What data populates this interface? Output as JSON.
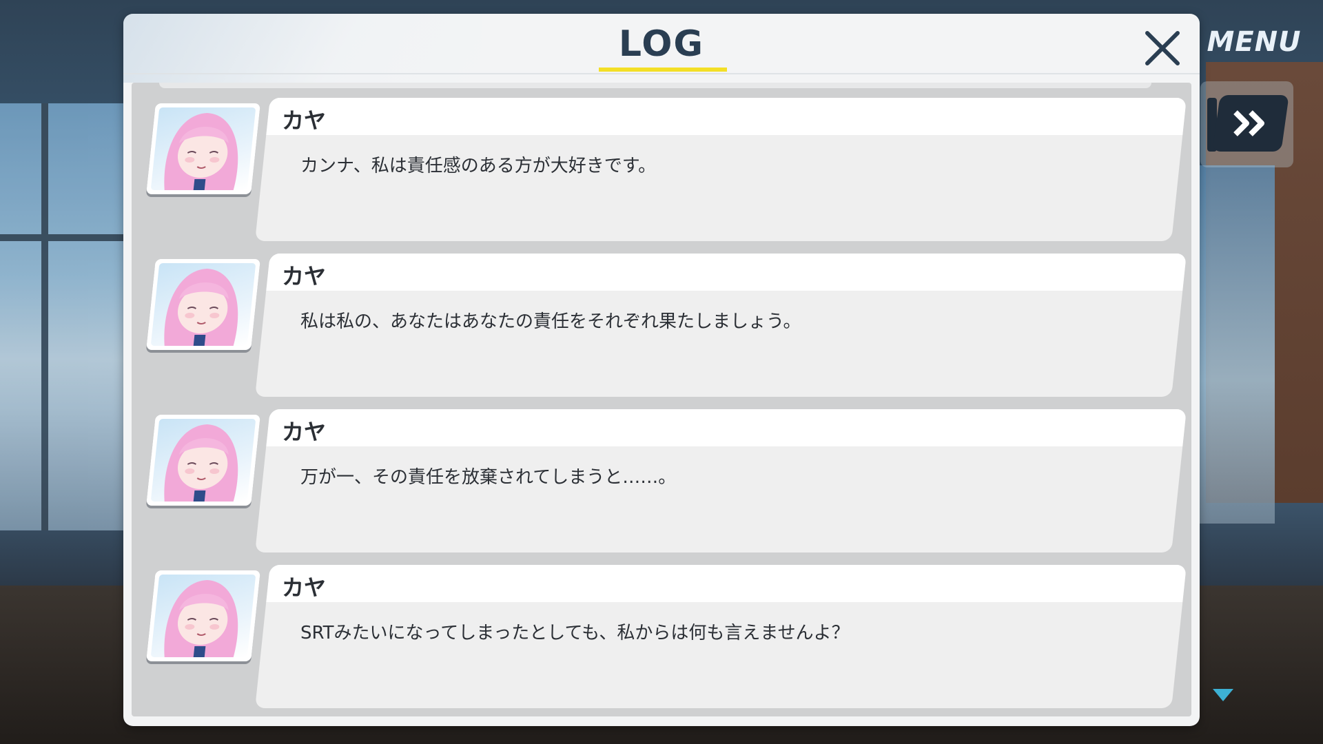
{
  "hud": {
    "menu_label": "MENU",
    "skip_icon": "double-chevron-right-icon",
    "scroll_icon": "triangle-down-icon",
    "accent_color": "#f3df26"
  },
  "log": {
    "title": "LOG",
    "close_icon": "close-x-icon",
    "entries": [
      {
        "speaker": "カヤ",
        "text": "カンナ、私は責任感のある方が大好きです。"
      },
      {
        "speaker": "カヤ",
        "text": "私は私の、あなたはあなたの責任をそれぞれ果たしましょう。"
      },
      {
        "speaker": "カヤ",
        "text": "万が一、その責任を放棄されてしまうと……。"
      },
      {
        "speaker": "カヤ",
        "text": "SRTみたいになってしまったとしても、私からは何も言えませんよ？"
      }
    ]
  }
}
